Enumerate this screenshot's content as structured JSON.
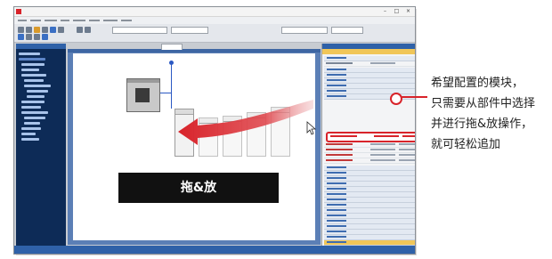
{
  "app": {
    "title": "",
    "window_controls": [
      "–",
      "□",
      "×"
    ]
  },
  "annotation": {
    "callout_lines": [
      "希望配置的模块，",
      "只需要从部件中选择",
      "并进行拖&放操作，",
      "就可轻松追加"
    ],
    "drag_label": "拖&放"
  },
  "colors": {
    "accent_red": "#d8232a",
    "tree_bg": "#0d2b57",
    "panel_blue": "#2f61a8",
    "label_bg": "#111111"
  },
  "icons": [
    "pointer-cursor-icon",
    "app-logo-icon",
    "drag-arrow-icon"
  ]
}
